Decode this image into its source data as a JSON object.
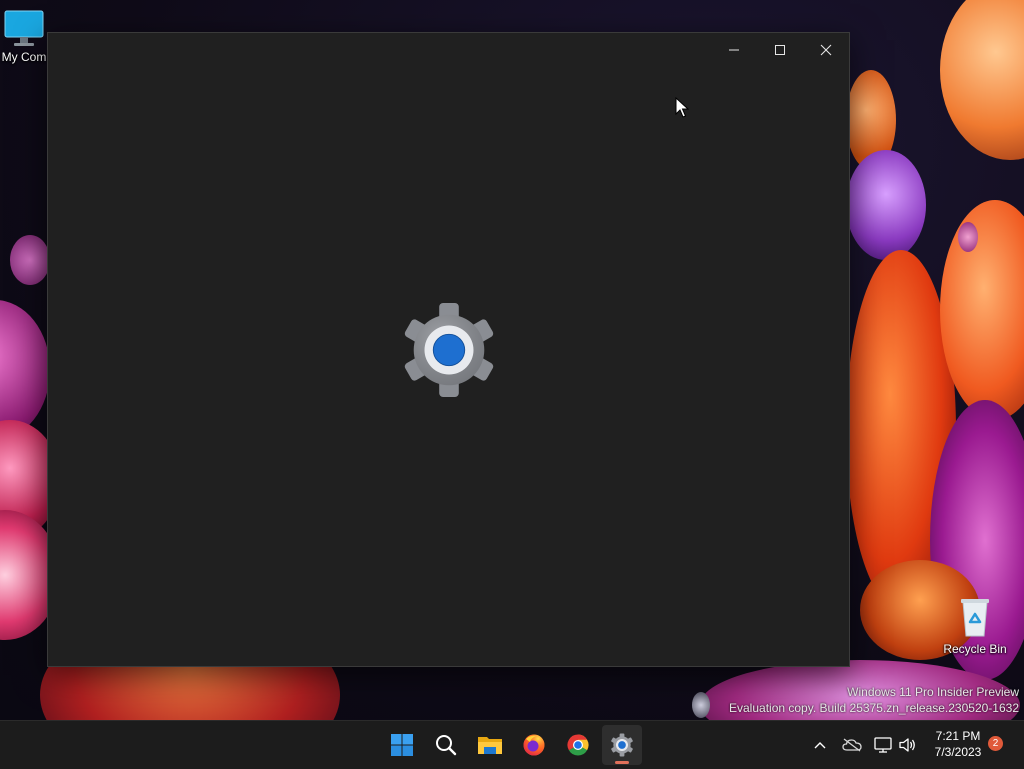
{
  "desktop": {
    "icons": [
      {
        "label": "My Com",
        "icon": "monitor-icon"
      },
      {
        "label": "Recycle Bin",
        "icon": "recycle-bin-icon"
      }
    ],
    "watermark": {
      "line1": "Windows 11 Pro Insider Preview",
      "line2": "Evaluation copy. Build 25375.zn_release.230520-1632"
    }
  },
  "window": {
    "app": "Settings",
    "state": "loading-splash",
    "background": "#202020",
    "splash_icon": "settings-gear-icon",
    "caption_buttons": [
      "minimize-icon",
      "maximize-icon",
      "close-icon"
    ]
  },
  "taskbar": {
    "pinned": [
      {
        "name": "Start",
        "icon": "windows-start-icon"
      },
      {
        "name": "Search",
        "icon": "search-icon"
      },
      {
        "name": "File Explorer",
        "icon": "folder-icon"
      },
      {
        "name": "Firefox",
        "icon": "firefox-icon"
      },
      {
        "name": "Chrome",
        "icon": "chrome-icon"
      },
      {
        "name": "Settings",
        "icon": "settings-gear-icon",
        "active": true
      }
    ],
    "tray": {
      "icons": [
        "chevron-up-icon",
        "onedrive-icon",
        "network-icon",
        "volume-icon"
      ],
      "time": "7:21 PM",
      "date": "7/3/2023",
      "notification_count": "2"
    }
  },
  "colors": {
    "accent_blue": "#1e6fd0",
    "gear_gray": "#8a8d93",
    "taskbar": "#1c1c1c",
    "badge": "#e05a3a"
  }
}
